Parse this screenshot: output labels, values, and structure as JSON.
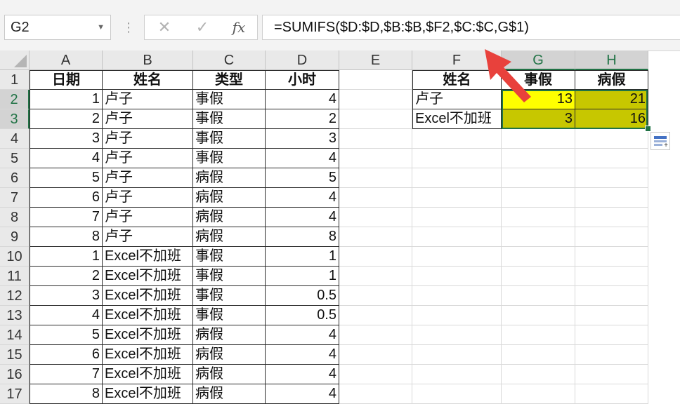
{
  "formula_bar": {
    "name_box": "G2",
    "cancel_icon": "✕",
    "enter_icon": "✓",
    "fx_label": "fx",
    "formula": "=SUMIFS($D:$D,$B:$B,$F2,$C:$C,G$1)"
  },
  "columns": [
    "A",
    "B",
    "C",
    "D",
    "E",
    "F",
    "G",
    "H"
  ],
  "rows": [
    "1",
    "2",
    "3",
    "4",
    "5",
    "6",
    "7",
    "8",
    "9",
    "10",
    "11",
    "12",
    "13",
    "14",
    "15",
    "16",
    "17"
  ],
  "data_table": {
    "headers": [
      "日期",
      "姓名",
      "类型",
      "小时"
    ],
    "rows": [
      [
        "1",
        "卢子",
        "事假",
        "4"
      ],
      [
        "2",
        "卢子",
        "事假",
        "2"
      ],
      [
        "3",
        "卢子",
        "事假",
        "3"
      ],
      [
        "4",
        "卢子",
        "事假",
        "4"
      ],
      [
        "5",
        "卢子",
        "病假",
        "5"
      ],
      [
        "6",
        "卢子",
        "病假",
        "4"
      ],
      [
        "7",
        "卢子",
        "病假",
        "4"
      ],
      [
        "8",
        "卢子",
        "病假",
        "8"
      ],
      [
        "1",
        "Excel不加班",
        "事假",
        "1"
      ],
      [
        "2",
        "Excel不加班",
        "事假",
        "1"
      ],
      [
        "3",
        "Excel不加班",
        "事假",
        "0.5"
      ],
      [
        "4",
        "Excel不加班",
        "事假",
        "0.5"
      ],
      [
        "5",
        "Excel不加班",
        "病假",
        "4"
      ],
      [
        "6",
        "Excel不加班",
        "病假",
        "4"
      ],
      [
        "7",
        "Excel不加班",
        "病假",
        "4"
      ],
      [
        "8",
        "Excel不加班",
        "病假",
        "4"
      ]
    ]
  },
  "summary_table": {
    "headers": [
      "姓名",
      "事假",
      "病假"
    ],
    "rows": [
      [
        "卢子",
        "13",
        "21"
      ],
      [
        "Excel不加班",
        "3",
        "16"
      ]
    ]
  },
  "colors": {
    "selection": "#217346",
    "active_cell_fill": "#ffff00",
    "range_fill": "#c7c700",
    "arrow": "#e8413c"
  },
  "icons": {
    "quick_analysis": "quick-analysis-icon",
    "annotation_arrow": "red-arrow-icon"
  }
}
